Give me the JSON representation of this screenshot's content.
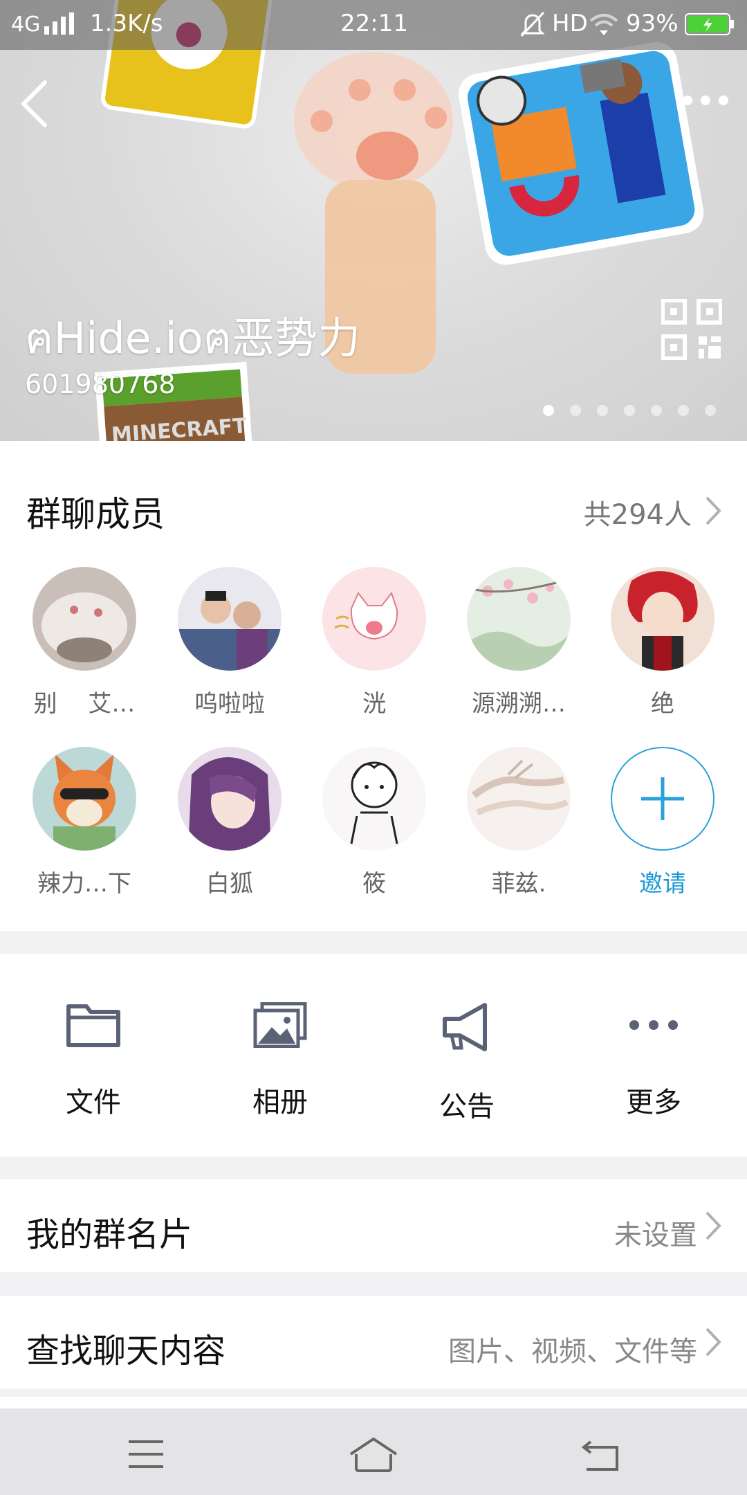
{
  "status_bar": {
    "network": "4G",
    "speed": "1.3K/s",
    "time": "22:11",
    "hd": "HD",
    "battery": "93%"
  },
  "header": {
    "group_name": "ฅHide.ioฅ恶势力",
    "group_id": "601980768",
    "page_count": 7,
    "active_page": 1
  },
  "members_section": {
    "title": "群聊成员",
    "count": "共294人",
    "members": [
      {
        "name": "别　 艾…"
      },
      {
        "name": "呜啦啦"
      },
      {
        "name": "洸"
      },
      {
        "name": "源溯溯…"
      },
      {
        "name": "绝"
      },
      {
        "name": "辣力…下"
      },
      {
        "name": "白狐"
      },
      {
        "name": "筱"
      },
      {
        "name": "菲兹."
      }
    ],
    "invite_label": "邀请"
  },
  "tools": [
    {
      "label": "文件",
      "icon": "folder-icon"
    },
    {
      "label": "相册",
      "icon": "album-icon"
    },
    {
      "label": "公告",
      "icon": "megaphone-icon"
    },
    {
      "label": "更多",
      "icon": "more-icon"
    }
  ],
  "settings": {
    "card_title": "我的群名片",
    "card_value": "未设置",
    "search_title": "查找聊天内容",
    "search_value": "图片、视频、文件等"
  },
  "colors": {
    "accent": "#1c9ad6",
    "icon_gray": "#5b6275"
  }
}
